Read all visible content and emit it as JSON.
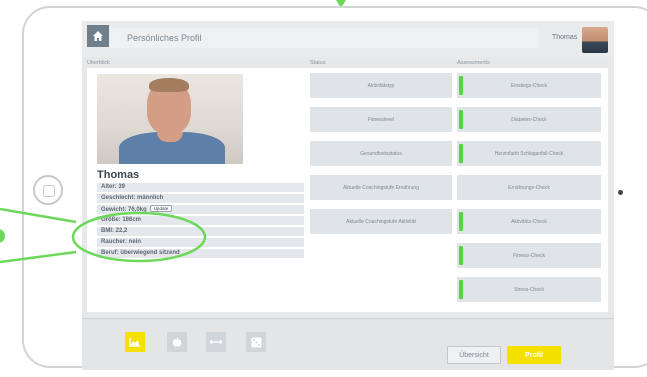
{
  "header": {
    "title": "Persönliches Profil",
    "user_name": "Thomas"
  },
  "columns": {
    "overview": "Überblick",
    "status": "Status",
    "assessments": "Assessments"
  },
  "profile": {
    "name": "Thomas",
    "details": [
      "Alter: 39",
      "Geschlecht: männlich",
      "Gewicht: 76,0kg",
      "Größe: 186cm",
      "BMI: 22,2",
      "Raucher: nein",
      "Beruf: überwiegend sitzend"
    ],
    "update_label": "Update"
  },
  "status_items": [
    "Aktivitätstyp",
    "Fitnesslevel",
    "Gesundheitsstatus",
    "Aktuelle Coachingstufe Ernährung",
    "Aktuelle Coachingstufe Aktivität"
  ],
  "assessments": [
    {
      "label": "Einstiegs-Check",
      "done": true
    },
    {
      "label": "Diabetes-Check",
      "done": true
    },
    {
      "label": "Herzinfarkt Schlaganfall-Check",
      "done": true
    },
    {
      "label": "Ernährungs-Check",
      "done": false
    },
    {
      "label": "Aktivitäts-Check",
      "done": true
    },
    {
      "label": "Fitness-Check",
      "done": true
    },
    {
      "label": "Stress-Check",
      "done": true
    }
  ],
  "bottom_nav": {
    "overview_label": "Übersicht",
    "profile_label": "Profil"
  },
  "icons": {
    "home": "home-icon",
    "chart": "chart-icon",
    "fruit": "apple-icon",
    "measure": "ruler-icon",
    "dice": "dice-icon"
  },
  "colors": {
    "accent_yellow": "#f4e100",
    "status_green": "#59d246",
    "annotation_green": "#6cd85a"
  }
}
